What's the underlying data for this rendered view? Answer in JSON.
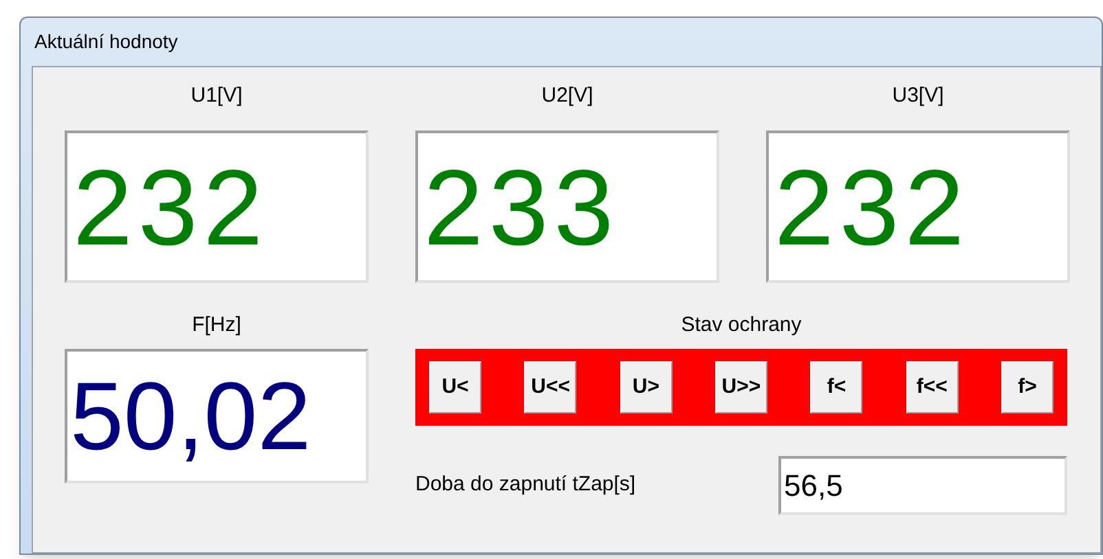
{
  "window": {
    "title": "Aktuální hodnoty"
  },
  "voltages": [
    {
      "label": "U1[V]",
      "value": "232"
    },
    {
      "label": "U2[V]",
      "value": "233"
    },
    {
      "label": "U3[V]",
      "value": "232"
    }
  ],
  "frequency": {
    "label": "F[Hz]",
    "value": "50,02"
  },
  "protection": {
    "label": "Stav ochrany",
    "tripped": true,
    "indicators": [
      "U<",
      "U<<",
      "U>",
      "U>>",
      "f<",
      "f<<",
      "f>"
    ]
  },
  "switch_on_time": {
    "label": "Doba do zapnutí tZap[s]",
    "value": "56,5"
  }
}
